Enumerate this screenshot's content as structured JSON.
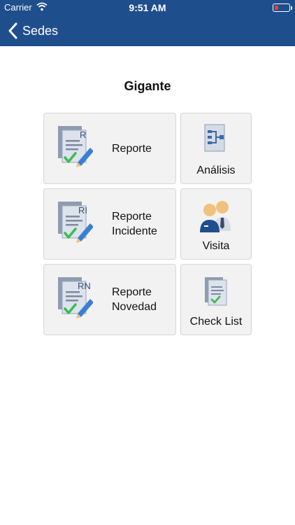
{
  "status_bar": {
    "carrier": "Carrier",
    "time": "9:51 AM"
  },
  "nav": {
    "back_label": "Sedes"
  },
  "page": {
    "title": "Gigante"
  },
  "tiles": {
    "reporte": {
      "badge": "R",
      "lines": [
        "Reporte"
      ],
      "icon": "report-icon"
    },
    "reporte_incidente": {
      "badge": "RI",
      "lines": [
        "Reporte",
        "Incidente"
      ],
      "icon": "incident-report-icon"
    },
    "reporte_novedad": {
      "badge": "RN",
      "lines": [
        "Reporte",
        "Novedad"
      ],
      "icon": "news-report-icon"
    },
    "analisis": {
      "label": "Análisis",
      "icon": "analysis-icon"
    },
    "visita": {
      "label": "Visita",
      "icon": "visit-icon"
    },
    "check_list": {
      "label": "Check List",
      "icon": "checklist-icon"
    }
  },
  "colors": {
    "header": "#1f4e8c",
    "tile_bg": "#f2f2f2",
    "check": "#3dbb4f",
    "pencil": "#3b7fd4"
  }
}
